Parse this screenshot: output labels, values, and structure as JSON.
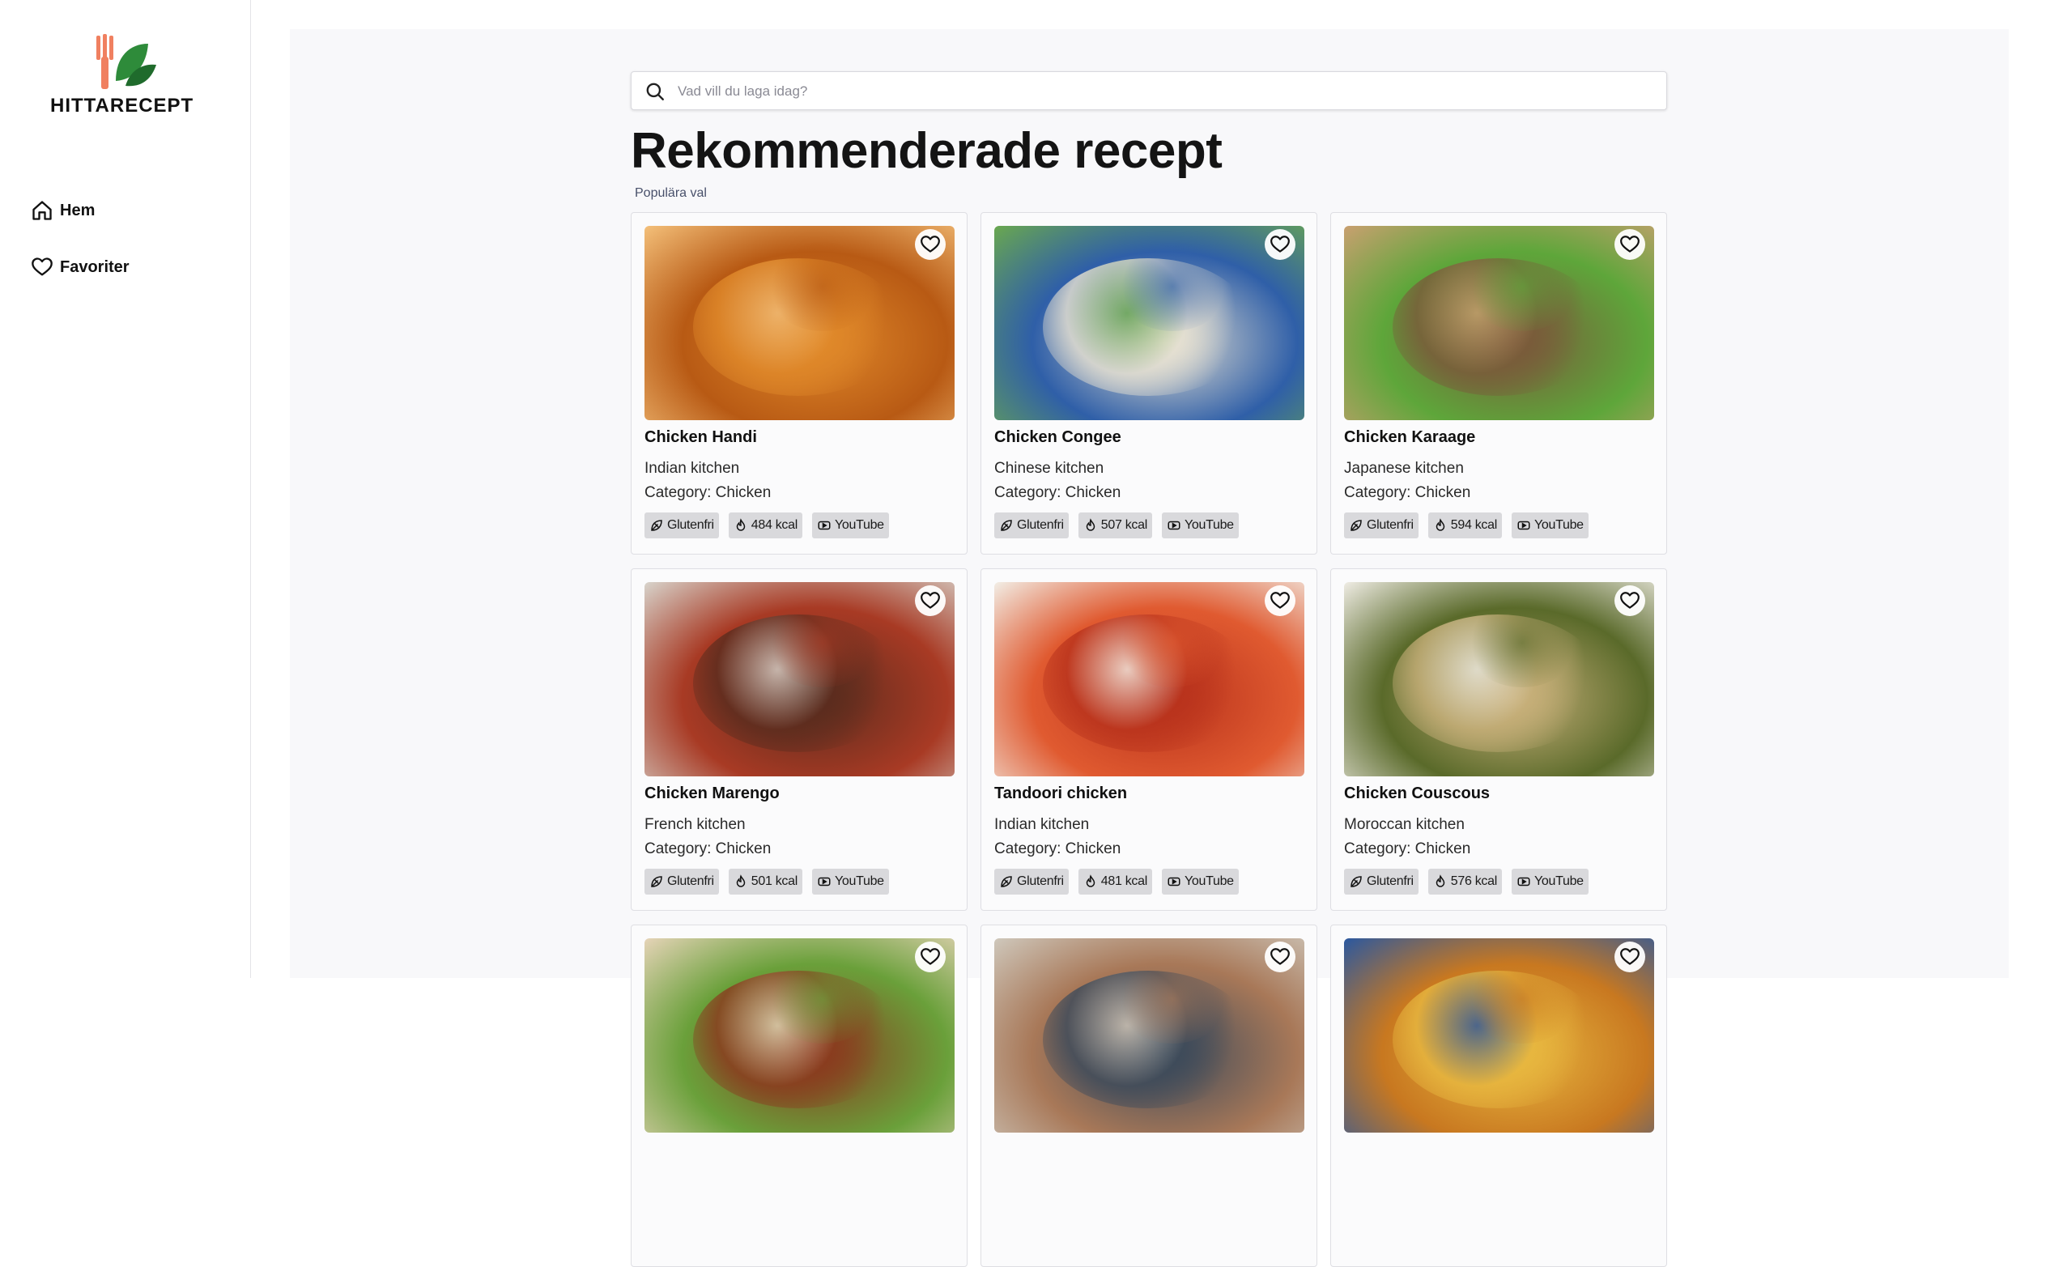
{
  "brand": {
    "name": "HITTARECEPT"
  },
  "nav": [
    {
      "label": "Hem",
      "icon": "home-icon"
    },
    {
      "label": "Favoriter",
      "icon": "heart-icon"
    }
  ],
  "search": {
    "placeholder": "Vad vill du laga idag?",
    "value": ""
  },
  "heading": {
    "title": "Rekommenderade recept",
    "subtitle": "Populära val"
  },
  "recipes": [
    {
      "name": "Chicken Handi",
      "kitchen": "Indian kitchen",
      "category": "Category: Chicken",
      "tags": [
        "Glutenfri",
        "484 kcal",
        "YouTube"
      ],
      "colors": [
        "#e0892a",
        "#b85a14",
        "#f4c07a"
      ]
    },
    {
      "name": "Chicken Congee",
      "kitchen": "Chinese kitchen",
      "category": "Category: Chicken",
      "tags": [
        "Glutenfri",
        "507 kcal",
        "YouTube"
      ],
      "colors": [
        "#e8e2d2",
        "#2f5fa8",
        "#6aa84f"
      ]
    },
    {
      "name": "Chicken Karaage",
      "kitchen": "Japanese kitchen",
      "category": "Category: Chicken",
      "tags": [
        "Glutenfri",
        "594 kcal",
        "YouTube"
      ],
      "colors": [
        "#7a5a3a",
        "#5ea63a",
        "#c9a070"
      ]
    },
    {
      "name": "Chicken Marengo",
      "kitchen": "French kitchen",
      "category": "Category: Chicken",
      "tags": [
        "Glutenfri",
        "501 kcal",
        "YouTube"
      ],
      "colors": [
        "#5a2c1e",
        "#a83a24",
        "#d8d4cc"
      ]
    },
    {
      "name": "Tandoori chicken",
      "kitchen": "Indian kitchen",
      "category": "Category: Chicken",
      "tags": [
        "Glutenfri",
        "481 kcal",
        "YouTube"
      ],
      "colors": [
        "#b8321c",
        "#e05a30",
        "#f2eee6"
      ]
    },
    {
      "name": "Chicken Couscous",
      "kitchen": "Moroccan kitchen",
      "category": "Category: Chicken",
      "tags": [
        "Glutenfri",
        "576 kcal",
        "YouTube"
      ],
      "colors": [
        "#c8b07a",
        "#5a6a2a",
        "#efece4"
      ]
    },
    {
      "name": "",
      "kitchen": "",
      "category": "",
      "tags": [],
      "colors": [
        "#8a3a1e",
        "#6aa03a",
        "#e6d4b8"
      ]
    },
    {
      "name": "",
      "kitchen": "",
      "category": "",
      "tags": [],
      "colors": [
        "#3c4a5a",
        "#a87858",
        "#cfc8bc"
      ]
    },
    {
      "name": "",
      "kitchen": "",
      "category": "",
      "tags": [],
      "colors": [
        "#e8b840",
        "#c87820",
        "#2a58a0"
      ]
    }
  ]
}
